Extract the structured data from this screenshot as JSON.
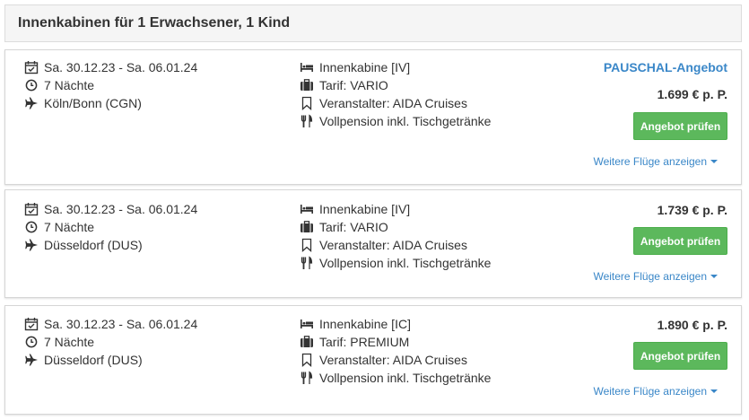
{
  "header": {
    "title": "Innenkabinen für 1 Erwachsener, 1 Kind"
  },
  "offers": [
    {
      "dates": "Sa. 30.12.23 - Sa. 06.01.24",
      "nights": "7 Nächte",
      "airport": "Köln/Bonn (CGN)",
      "cabin": "Innenkabine [IV]",
      "tariff": "Tarif: VARIO",
      "operator": "Veranstalter: AIDA Cruises",
      "board": "Vollpension inkl. Tischgetränke",
      "badge": "PAUSCHAL-Angebot",
      "price": "1.699 € p. P.",
      "button": "Angebot prüfen",
      "more_flights": "Weitere Flüge anzeigen"
    },
    {
      "dates": "Sa. 30.12.23 - Sa. 06.01.24",
      "nights": "7 Nächte",
      "airport": "Düsseldorf (DUS)",
      "cabin": "Innenkabine [IV]",
      "tariff": "Tarif: VARIO",
      "operator": "Veranstalter: AIDA Cruises",
      "board": "Vollpension inkl. Tischgetränke",
      "price": "1.739 € p. P.",
      "button": "Angebot prüfen",
      "more_flights": "Weitere Flüge anzeigen"
    },
    {
      "dates": "Sa. 30.12.23 - Sa. 06.01.24",
      "nights": "7 Nächte",
      "airport": "Düsseldorf (DUS)",
      "cabin": "Innenkabine [IC]",
      "tariff": "Tarif: PREMIUM",
      "operator": "Veranstalter: AIDA Cruises",
      "board": "Vollpension inkl. Tischgetränke",
      "price": "1.890 € p. P.",
      "button": "Angebot prüfen",
      "more_flights": "Weitere Flüge anzeigen"
    }
  ],
  "icons": {
    "dates": "calendar-check-icon",
    "nights": "clock-icon",
    "airport": "plane-icon",
    "cabin": "bed-icon",
    "tariff": "suitcase-icon",
    "operator": "bookmark-icon",
    "board": "cutlery-icon"
  },
  "colors": {
    "accent_link": "#3a87c8",
    "button_green": "#5cb85c",
    "header_bg": "#f5f5f5",
    "text": "#333333"
  }
}
